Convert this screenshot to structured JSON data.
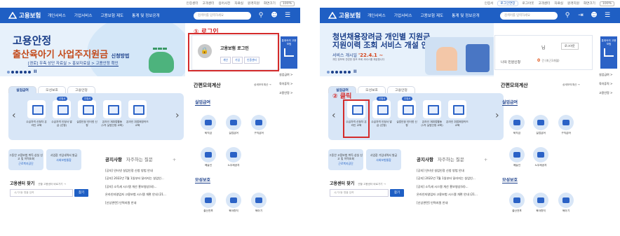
{
  "left": {
    "topbar": [
      "인증센터",
      "고객센터",
      "용어사전",
      "자료실",
      "원격지원",
      "화면크기",
      "100%"
    ],
    "header": {
      "logo": "고용보험",
      "nav": [
        "개인서비스",
        "기업서비스",
        "고용보험 제도",
        "통계 및 정보공개"
      ],
      "search_placeholder": "검색어를 입력하세요"
    },
    "banner": {
      "title": "고용안정",
      "subtitle": "출산육아기 사업주지원금",
      "subtitle_suffix": "신청방법",
      "note": "[경로] 우측 상단 자료실 > 홍보자료실 > 고용안정 확인"
    },
    "step_label": "① 로그인",
    "login": {
      "title": "고용보험 로그인",
      "buttons": [
        "개인",
        "기업",
        "인증센터"
      ]
    },
    "side": {
      "button": "통계속의 고용보험",
      "links": [
        "실업급여 >",
        "육아휴직 >",
        "고용안정 >"
      ]
    },
    "tabs": [
      "실업급여",
      "모성보호",
      "고용안정"
    ],
    "services": [
      {
        "label": "수급자격 신청자 온라인 교육",
        "badge": ""
      },
      {
        "label": "수급자격 인정서 발급 (신청)",
        "badge": "신청서"
      },
      {
        "label": "실업인정 인터넷 신청",
        "badge": "인정서"
      },
      {
        "label": "온라인 재취업활동 (1차 실업인정 교육)",
        "badge": ""
      },
      {
        "label": "온라인 취업희망카드 교육",
        "badge": ""
      }
    ],
    "mini1": {
      "text": "그동안 고용보험 취득·상실 신고 및 이력조회",
      "link": "근로복지공단"
    },
    "mini2": {
      "text": "사업장 가입내역서 발급",
      "link": "사회보험통합"
    },
    "notice": {
      "title": "공지사항",
      "faq": "자주하는 질문",
      "plus": "+",
      "items": [
        "[공지] 인터넷 실업인정 신청 방법 안내",
        "[공지] 2022년 7월 1일부터 달라지는 실업인...",
        "[공지] 소득세 시스템 개선 홍보영상(외)...",
        "온라인자영업자 고용보험 시스템 개편 안내 (21...",
        "[신상관련] 인력지원 안내"
      ]
    },
    "center": {
      "title": "고용센터 찾기",
      "sub": "관할 고용센터 바로가기 →",
      "placeholder": "시/구/동 명을 입력",
      "button": "찾기"
    },
    "calc": {
      "title": "간편모의계산",
      "link": "상세모의계산 →",
      "unemp": "실업급여",
      "unemp_items": [
        "퇴직금",
        "실업급여",
        "구직급여"
      ],
      "extra": [
        "예술인",
        "노무제공자"
      ],
      "mat": "모성보호",
      "mat_items": [
        "출산전후",
        "육아휴직",
        "육아기"
      ]
    }
  },
  "right": {
    "topbar": [
      "인증서",
      "로그인연장",
      "로그아웃",
      "고객센터",
      "자료실",
      "원격지원",
      "화면크기",
      "100%"
    ],
    "header": {
      "logo": "고용보험",
      "nav": [
        "개인서비스",
        "기업서비스",
        "고용보험 제도",
        "통계 및 정보공개"
      ],
      "search_placeholder": "검색어를 입력하세요"
    },
    "banner": {
      "title": "청년채용장려금 개인별 지원금",
      "title2": "지원이력 조회 서비스 개설 안내",
      "date_label": "서비스 개시일",
      "date": "'22.4.1 ~",
      "fine": "개인 정보와 관련한 정보 조회 서비스를 제공합니다"
    },
    "step_label": "② 클릭",
    "user": {
      "name": "님",
      "logout": "로그아웃",
      "line": "나의 민원신청",
      "count": "0",
      "count_suffix": "건 (최근3개월)"
    },
    "side": {
      "button": "통계속의 고용보험",
      "links": [
        "실업급여 >",
        "육아휴직 >",
        "고용안정 >"
      ]
    },
    "tabs": [
      "실업급여",
      "모성보호",
      "고용안정"
    ],
    "services": [
      {
        "label": "수급자격 신청자 온라인 교육",
        "badge": ""
      },
      {
        "label": "수급자격 인정서 발급 (신청)",
        "badge": "신청서"
      },
      {
        "label": "실업인정 인터넷 신청",
        "badge": "인정서"
      },
      {
        "label": "온라인 재취업활동 (1차 실업인정 교육)",
        "badge": ""
      },
      {
        "label": "온라인 취업희망카드 교육",
        "badge": ""
      }
    ],
    "mini1": {
      "text": "그동안 고용보험 취득·상실 신고 및 이력조회",
      "link": "근로복지공단"
    },
    "mini2": {
      "text": "사업장 가입내역서 발급",
      "link": "사회보험통합"
    },
    "notice": {
      "title": "공지사항",
      "faq": "자주하는 질문",
      "plus": "+",
      "items": [
        "[공지] 인터넷 실업인정 신청 방법 안내",
        "[공지] 2022년 7월 1일부터 달라지는 실업인...",
        "[공지] 소득세 시스템 개선 홍보영상(외)...",
        "온라인자영업자 고용보험 시스템 개편 안내 (21...",
        "[신상관련] 인력지원 안내"
      ]
    },
    "center": {
      "title": "고용센터 찾기",
      "sub": "관할 고용센터 바로가기 →",
      "placeholder": "시/구/동 명을 입력",
      "button": "찾기"
    },
    "calc": {
      "title": "간편모의계산",
      "link": "상세모의계산 →",
      "unemp": "실업급여",
      "unemp_items": [
        "퇴직금",
        "실업급여",
        "구직급여"
      ],
      "extra": [
        "예술인",
        "노무제공자"
      ],
      "mat": "모성보호",
      "mat_items": [
        "출산전후",
        "육아휴직",
        "육아기"
      ]
    }
  },
  "colors": {
    "brand": "#1f5fc4",
    "highlight": "#d42b2b",
    "panel": "#d8e6f7"
  }
}
